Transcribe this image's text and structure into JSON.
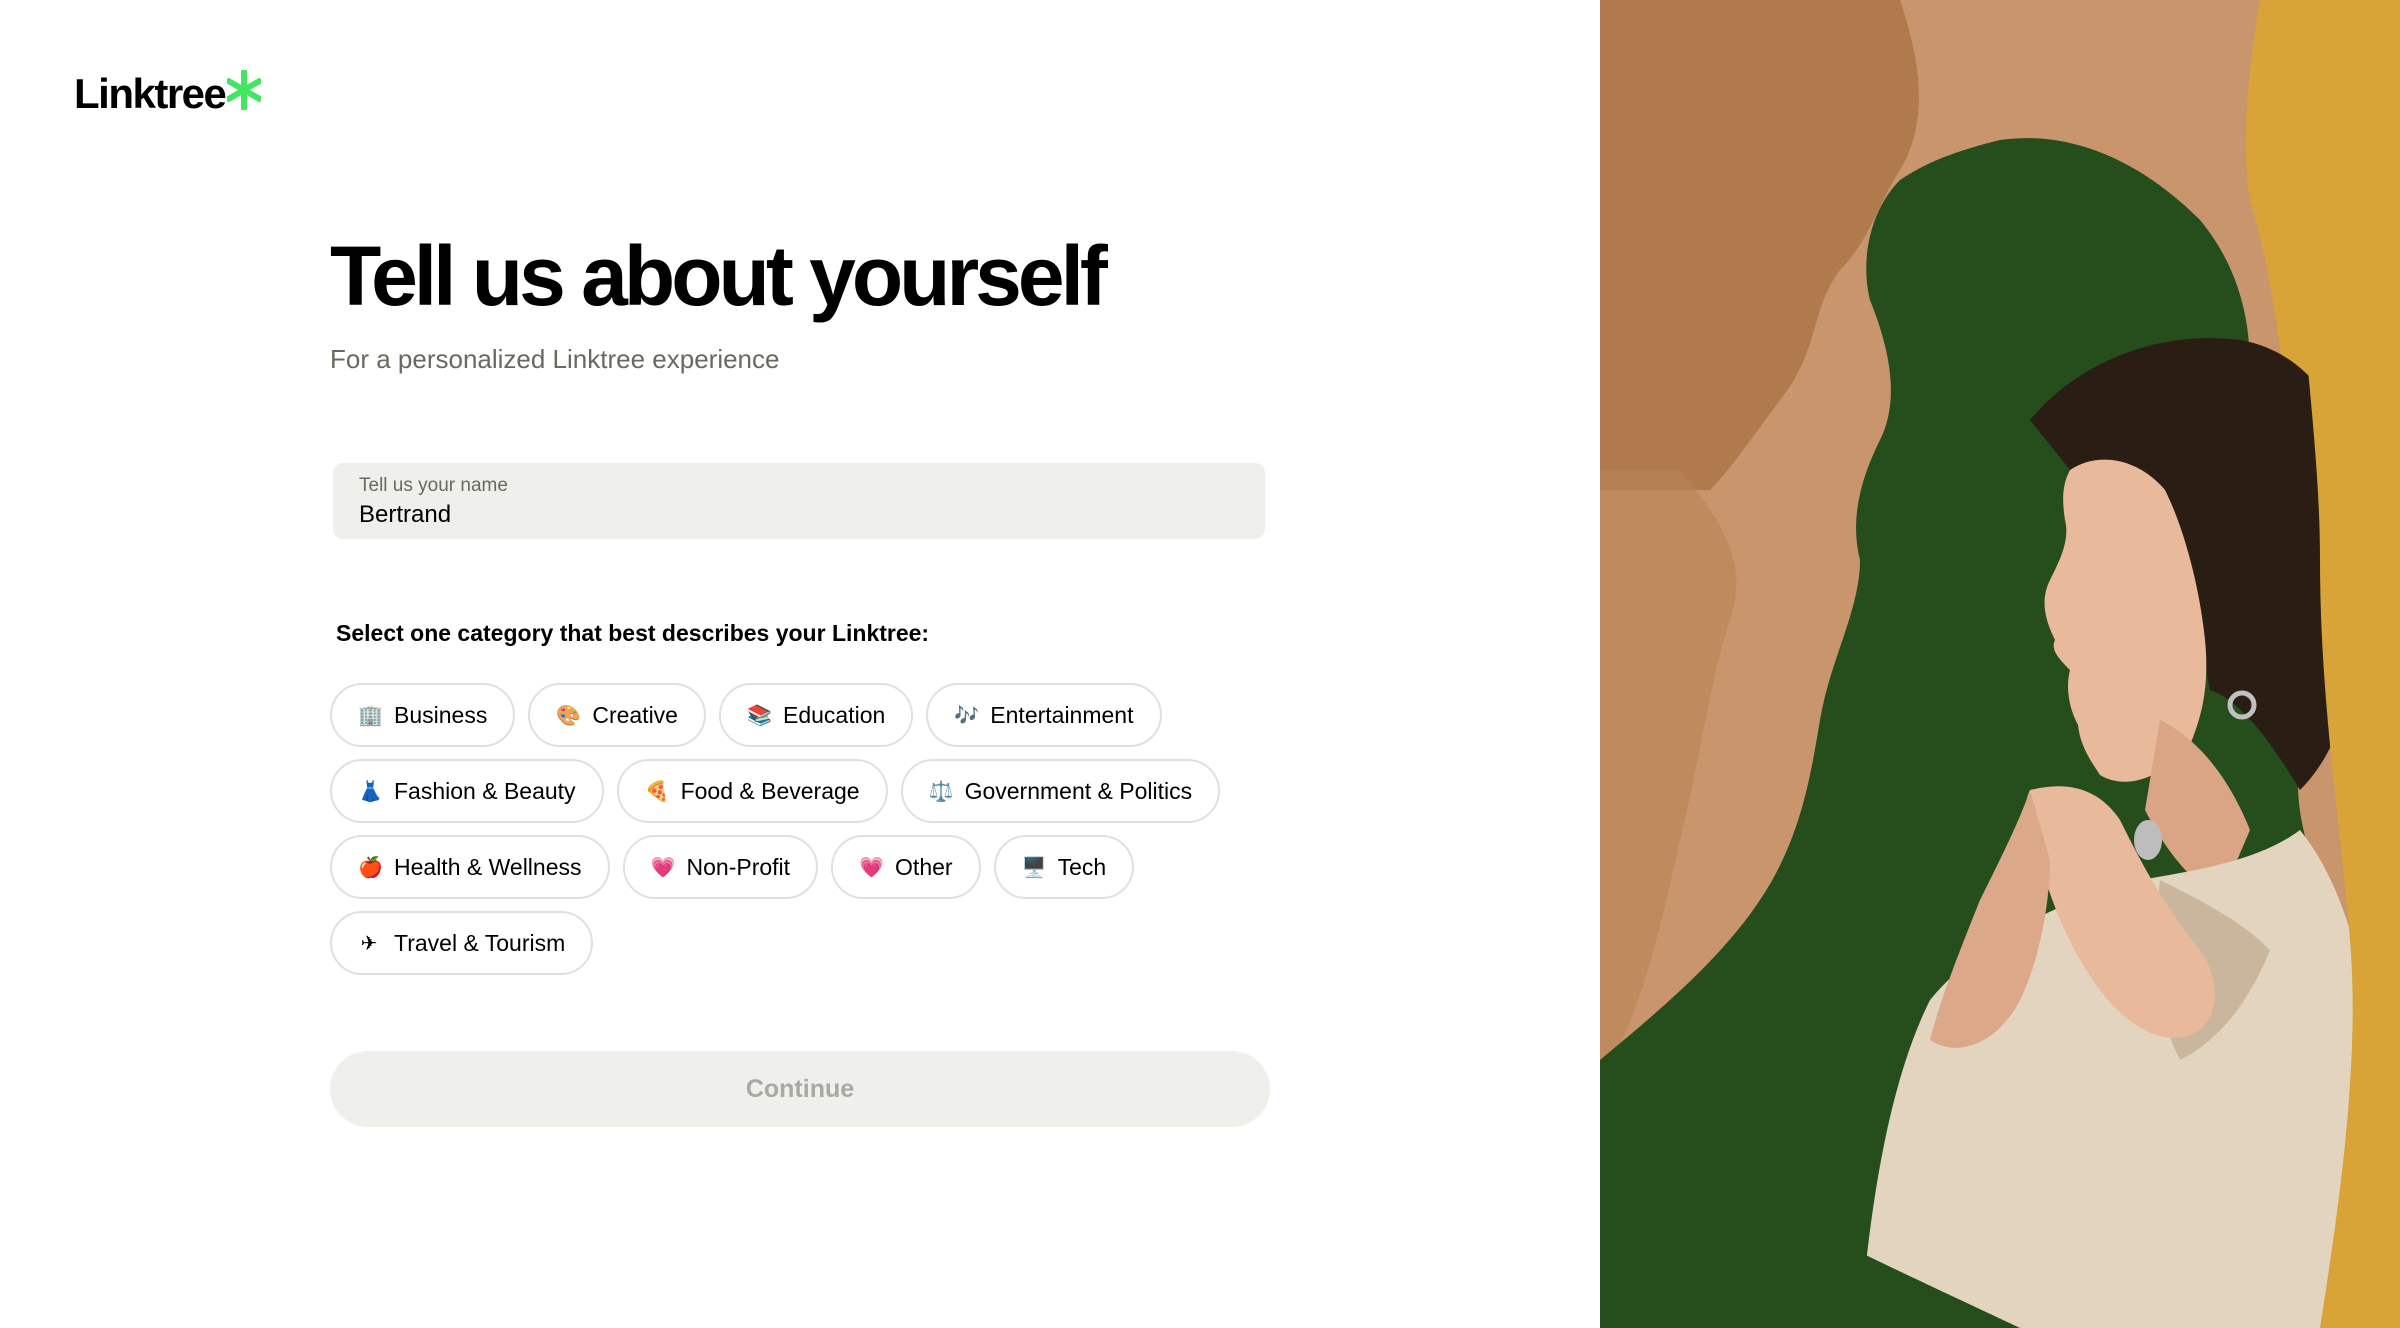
{
  "brand": {
    "name": "Linktree",
    "accent_color": "#43e660"
  },
  "heading": {
    "title": "Tell us about yourself",
    "subtitle": "For a personalized Linktree experience"
  },
  "name_field": {
    "label": "Tell us your name",
    "value": "Bertrand"
  },
  "categories": {
    "heading": "Select one category that best describes your Linktree:",
    "items": [
      {
        "emoji": "🏢",
        "label": "Business"
      },
      {
        "emoji": "🎨",
        "label": "Creative"
      },
      {
        "emoji": "📚",
        "label": "Education"
      },
      {
        "emoji": "🎶",
        "label": "Entertainment"
      },
      {
        "emoji": "👗",
        "label": "Fashion & Beauty"
      },
      {
        "emoji": "🍕",
        "label": "Food & Beverage"
      },
      {
        "emoji": "⚖️",
        "label": "Government & Politics"
      },
      {
        "emoji": "🍎",
        "label": "Health & Wellness"
      },
      {
        "emoji": "💗",
        "label": "Non-Profit"
      },
      {
        "emoji": "💗",
        "label": "Other"
      },
      {
        "emoji": "🖥️",
        "label": "Tech"
      },
      {
        "emoji": "✈",
        "label": "Travel & Tourism"
      }
    ]
  },
  "continue_button": {
    "label": "Continue",
    "enabled": false
  },
  "hero_image": {
    "colors": {
      "background": "#d8a437",
      "paper": "#c9956c",
      "green": "#264d1c",
      "skin": "#e8b99a"
    }
  }
}
